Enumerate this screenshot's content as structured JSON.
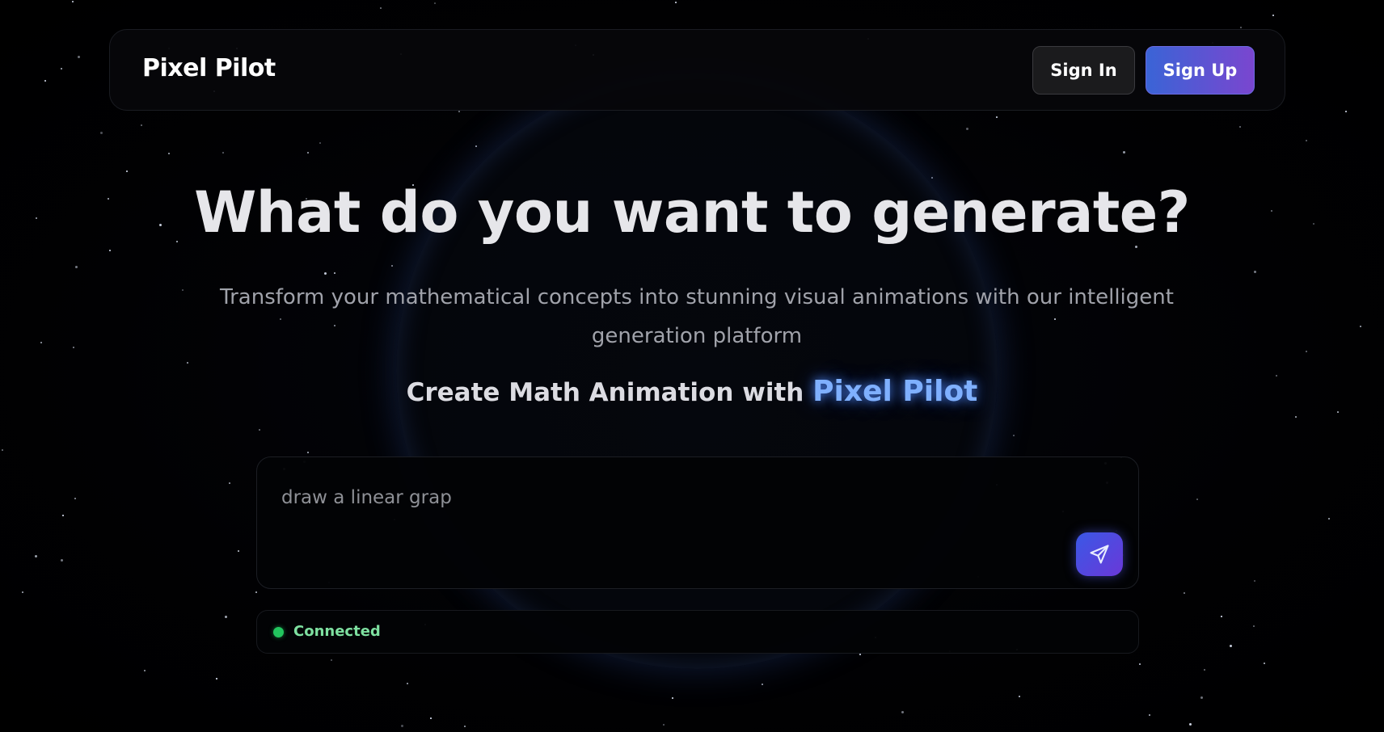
{
  "colors": {
    "background": "#000000",
    "brand_accent": "#7fb0ff",
    "signup_gradient_start": "#3a64d6",
    "signup_gradient_end": "#7a46cf",
    "status_connected": "#22c55e"
  },
  "navbar": {
    "brand": "Pixel Pilot",
    "sign_in_label": "Sign In",
    "sign_up_label": "Sign Up"
  },
  "hero": {
    "title": "What do you want to generate?",
    "subtitle": "Transform your mathematical concepts into stunning visual animations with our intelligent generation platform",
    "tagline_prefix": "Create Math Animation with",
    "tagline_brand": "Pixel Pilot"
  },
  "prompt": {
    "value": "draw a linear grap",
    "send_icon": "paper-plane-icon"
  },
  "status": {
    "text": "Connected",
    "state": "connected"
  }
}
